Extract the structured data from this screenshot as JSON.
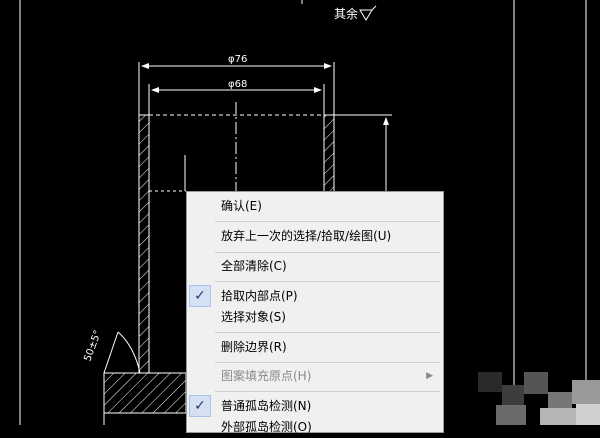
{
  "drawing": {
    "surface_label": "其余",
    "dim_outer": "φ76",
    "dim_inner": "φ68",
    "angle_dim": "50±5°"
  },
  "context_menu": {
    "items": [
      {
        "label": "确认(E)",
        "enabled": true,
        "checked": false
      },
      {
        "label": "放弃上一次的选择/拾取/绘图(U)",
        "enabled": true,
        "checked": false
      },
      {
        "label": "全部清除(C)",
        "enabled": true,
        "checked": false
      },
      {
        "label": "拾取内部点(P)",
        "enabled": true,
        "checked": true
      },
      {
        "label": "选择对象(S)",
        "enabled": true,
        "checked": false
      },
      {
        "label": "删除边界(R)",
        "enabled": true,
        "checked": false
      },
      {
        "label": "图案填充原点(H)",
        "enabled": false,
        "checked": false,
        "submenu": true
      },
      {
        "label": "普通孤岛检测(N)",
        "enabled": true,
        "checked": true
      },
      {
        "label": "外部孤岛检测(O)",
        "enabled": true,
        "checked": false
      }
    ],
    "check_glyph": "✓",
    "submenu_glyph": "▶"
  },
  "annotation": {
    "arrow_color": "#e8262a"
  }
}
